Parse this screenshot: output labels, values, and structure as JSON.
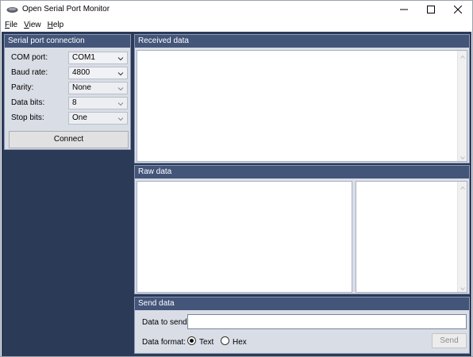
{
  "window": {
    "title": "Open Serial Port Monitor"
  },
  "menu": {
    "items": [
      {
        "accel": "F",
        "rest": "ile"
      },
      {
        "accel": "V",
        "rest": "iew"
      },
      {
        "accel": "H",
        "rest": "elp"
      }
    ]
  },
  "connection": {
    "header": "Serial port connection",
    "fields": [
      {
        "label": "COM port:",
        "value": "COM1"
      },
      {
        "label": "Baud rate:",
        "value": "4800"
      },
      {
        "label": "Parity:",
        "value": "None"
      },
      {
        "label": "Data bits:",
        "value": "8"
      },
      {
        "label": "Stop bits:",
        "value": "One"
      }
    ],
    "connect_label": "Connect"
  },
  "received": {
    "header": "Received data"
  },
  "raw": {
    "header": "Raw data"
  },
  "send": {
    "header": "Send data",
    "data_label": "Data to send:",
    "input_value": "",
    "format_label": "Data format:",
    "options": [
      {
        "label": "Text",
        "checked": true
      },
      {
        "label": "Hex",
        "checked": false
      }
    ],
    "send_label": "Send"
  },
  "icons": {
    "app": "serial-plug-icon",
    "minimize": "minimize-icon",
    "maximize": "maximize-icon",
    "close": "close-icon",
    "chevron": "chevron-down-icon",
    "scroll_up": "scroll-up-arrow-icon",
    "scroll_down": "scroll-down-arrow-icon"
  },
  "colors": {
    "main_background": "#2b3a57",
    "panel_header": "#44557a",
    "panel_body": "#d9dde6"
  }
}
